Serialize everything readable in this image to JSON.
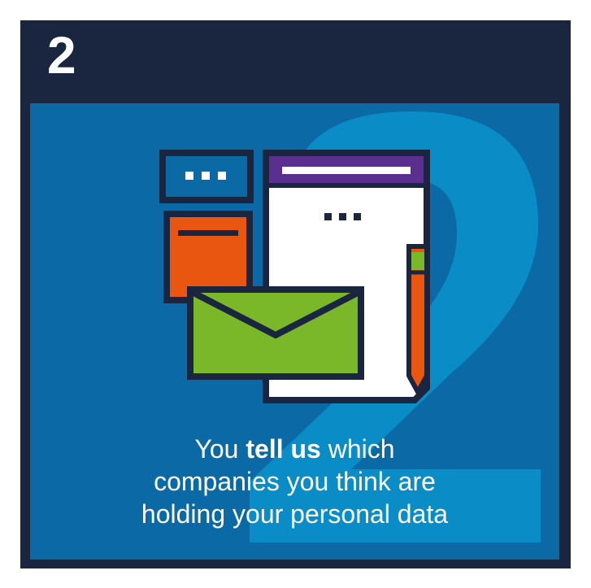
{
  "step": {
    "number": "2"
  },
  "caption": {
    "line1_before": "You ",
    "line1_bold": "tell us",
    "line1_after": " which",
    "line2": "companies you think are",
    "line3": "holding your personal data"
  },
  "colors": {
    "frame": "#1a2540",
    "panel": "#0b6aa5",
    "watermark": "#0a8cc6",
    "orange": "#e8560f",
    "green": "#7ab829",
    "purple": "#5b2f8f",
    "white": "#ffffff"
  },
  "icons": [
    "message-window-icon",
    "document-icon",
    "sticky-note-icon",
    "envelope-icon",
    "pencil-icon"
  ]
}
